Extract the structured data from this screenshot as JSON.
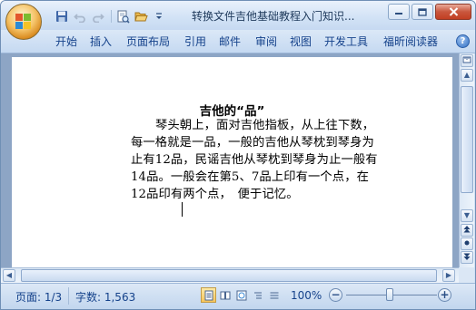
{
  "window": {
    "title": "转换文件吉他基础教程入门知识..."
  },
  "quick_access": {
    "icons": [
      "save-icon",
      "undo-icon",
      "redo-icon",
      "print-preview-icon",
      "open-icon",
      "customize-icon"
    ]
  },
  "ribbon": {
    "tabs": [
      "开始",
      "插入",
      "页面布局",
      "引用",
      "邮件",
      "审阅",
      "视图",
      "开发工具",
      "福昕阅读器"
    ],
    "help_label": "?"
  },
  "document": {
    "title": "吉他的“品”",
    "body": "琴头朝上，面对吉他指板，从上往下数，每一格就是一品，一般的吉他从琴枕到琴身为止有12品，民谣吉他从琴枕到琴身为止一般有14品。一般会在第5、7品上印有一个点，在12品印有两个点，　便于记忆。"
  },
  "statusbar": {
    "page": "页面: 1/3",
    "word_count": "字数: 1,563",
    "zoom": "100%",
    "zoom_minus": "−",
    "zoom_plus": "+"
  },
  "colors": {
    "accent": "#15428b",
    "doc_background": "#8da5c5",
    "active_view": "#f7c55a"
  }
}
